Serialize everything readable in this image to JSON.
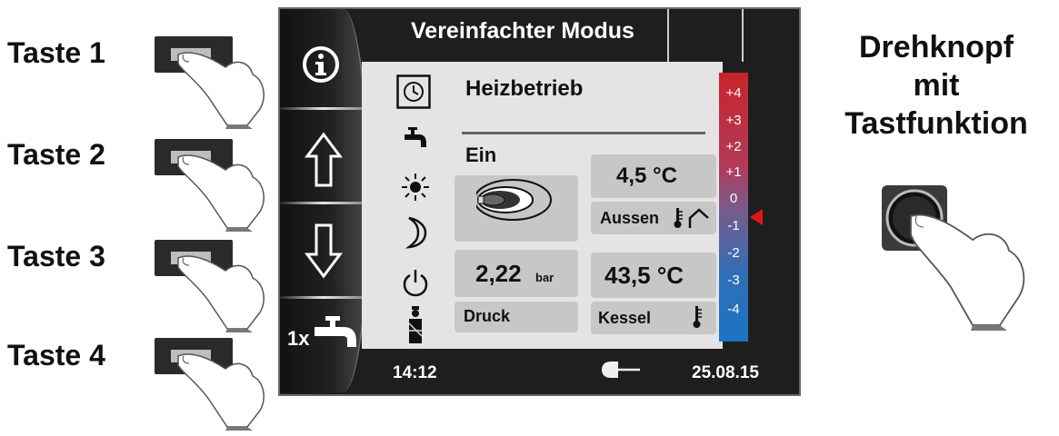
{
  "keys": [
    {
      "label": "Taste 1"
    },
    {
      "label": "Taste 2"
    },
    {
      "label": "Taste 3"
    },
    {
      "label": "Taste 4"
    }
  ],
  "knob": {
    "line1": "Drehknopf",
    "line2": "mit",
    "line3": "Tastfunktion"
  },
  "screen": {
    "title": "Vereinfachter Modus",
    "mode": "Heizbetrieb",
    "state": "Ein",
    "outside_temp": "4,5 °C",
    "outside_label": "Aussen",
    "pressure_value": "2,22",
    "pressure_unit": "bar",
    "pressure_label": "Druck",
    "boiler_temp": "43,5 °C",
    "boiler_label": "Kessel",
    "hotwater_label": "1x",
    "time": "14:12",
    "date": "25.08.15",
    "scale": [
      "+4",
      "+3",
      "+2",
      "+1",
      "0",
      "-1",
      "-2",
      "-3",
      "-4"
    ],
    "scale_marker_value": "0"
  },
  "colors": {
    "scale_top": "#c8242b",
    "scale_bottom": "#1a74c4",
    "marker": "#e0161b"
  },
  "icons": [
    "info-icon",
    "arrow-up-icon",
    "arrow-down-icon",
    "tap-icon",
    "clock-icon",
    "faucet-icon",
    "sun-icon",
    "moon-icon",
    "power-icon",
    "chimney-sweep-icon",
    "burner-flame-icon",
    "thermometer-icon",
    "house-icon",
    "plug-icon"
  ]
}
